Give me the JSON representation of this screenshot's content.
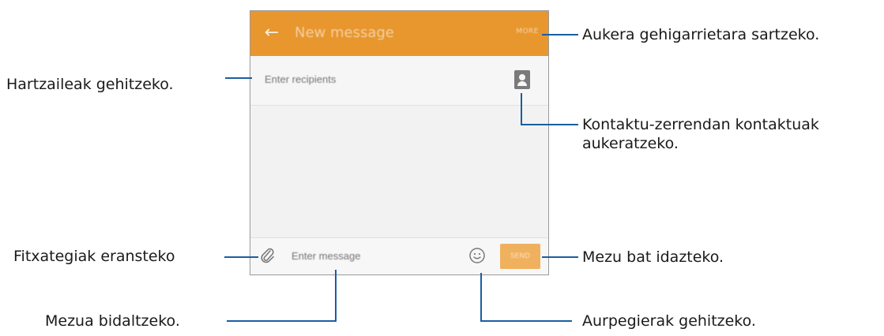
{
  "app": {
    "title": "New message",
    "more_label": "MORE",
    "recipients_placeholder": "Enter recipients",
    "message_placeholder": "Enter message",
    "send_label": "SEND"
  },
  "callouts": {
    "more": "Aukera gehigarrietara sartzeko.",
    "recipients": "Hartzaileak gehitzeko.",
    "contacts": "Kontaktu-zerrendan kontaktuak aukeratzeko.",
    "attach": "Fitxategiak eransteko",
    "send": "Mezu bat idazteko.",
    "message": "Mezua bidaltzeko.",
    "emoticons": "Aurpegierak gehitzeko."
  },
  "colors": {
    "appbar": "#e8962e",
    "send_button": "#f0b15f",
    "callout_line": "#1b5ea0"
  },
  "icons": [
    "back-arrow-icon",
    "contact-icon",
    "paperclip-icon",
    "smiley-icon"
  ]
}
